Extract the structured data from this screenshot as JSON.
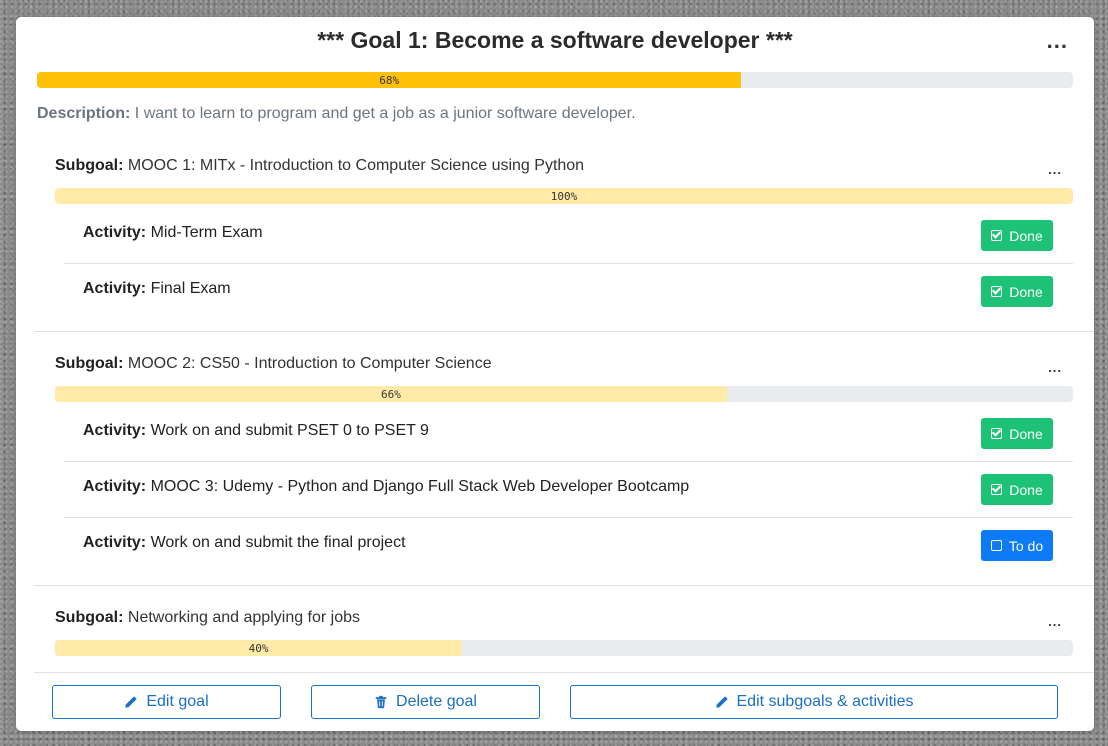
{
  "goal": {
    "title": "*** Goal 1: Become a software developer ***",
    "menu": "...",
    "progress_label": "68%",
    "progress_value": 68,
    "description_label": "Description:",
    "description_text": "I want to learn to program and get a job as a junior software developer."
  },
  "subgoals": [
    {
      "label": "Subgoal:",
      "title": "MOOC 1: MITx - Introduction to Computer Science using Python",
      "menu": "...",
      "progress_label": "100%",
      "progress_value": 100,
      "activities": [
        {
          "label": "Activity:",
          "title": "Mid-Term Exam",
          "status": "Done"
        },
        {
          "label": "Activity:",
          "title": "Final Exam",
          "status": "Done"
        }
      ]
    },
    {
      "label": "Subgoal:",
      "title": "MOOC 2: CS50 - Introduction to Computer Science",
      "menu": "...",
      "progress_label": "66%",
      "progress_value": 66,
      "activities": [
        {
          "label": "Activity:",
          "title": "Work on and submit PSET 0 to PSET 9",
          "status": "Done"
        },
        {
          "label": "Activity:",
          "title": "MOOC 3: Udemy - Python and Django Full Stack Web Developer Bootcamp",
          "status": "Done"
        },
        {
          "label": "Activity:",
          "title": "Work on and submit the final project",
          "status": "To do"
        }
      ]
    },
    {
      "label": "Subgoal:",
      "title": "Networking and applying for jobs",
      "menu": "...",
      "progress_label": "40%",
      "progress_value": 40,
      "activities": []
    }
  ],
  "actions": {
    "edit_goal": "Edit goal",
    "delete_goal": "Delete goal",
    "edit_subgoals": "Edit subgoals & activities"
  },
  "colors": {
    "goal_progress": "#ffc107",
    "subgoal_progress": "#ffeaa8",
    "done_button": "#1ec276",
    "todo_button": "#0d7bf5",
    "outline_button": "#1a73c9"
  }
}
